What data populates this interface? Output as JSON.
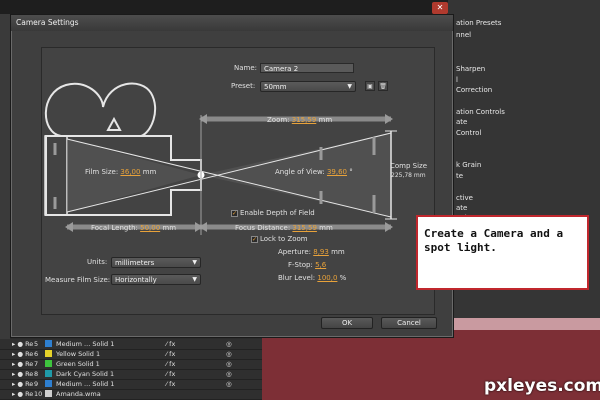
{
  "background": {
    "right_panel_items": [
      "ation Presets",
      "nnel",
      "Sharpen",
      "l",
      "Correction",
      "ation Controls",
      "ate",
      "Control",
      "k Grain",
      "te",
      "ctive",
      "ate",
      "nel"
    ]
  },
  "dialog": {
    "title": "Camera Settings",
    "name_label": "Name:",
    "name_value": "Camera 2",
    "preset_label": "Preset:",
    "preset_value": "50mm",
    "zoom_label": "Zoom:",
    "zoom_value": "315,59",
    "zoom_unit": "mm",
    "film_size_label": "Film Size:",
    "film_size_value": "36,00",
    "film_size_unit": "mm",
    "angle_label": "Angle of View:",
    "angle_value": "39,60",
    "angle_unit": "°",
    "comp_size_label": "Comp Size",
    "comp_size_value": "225,78 mm",
    "focal_length_label": "Focal Length:",
    "focal_length_value": "50,00",
    "focal_length_unit": "mm",
    "enable_dof_label": "Enable Depth of Field",
    "enable_dof_checked": true,
    "focus_distance_label": "Focus Distance:",
    "focus_distance_value": "315,59",
    "focus_distance_unit": "mm",
    "lock_zoom_label": "Lock to Zoom",
    "lock_zoom_checked": true,
    "aperture_label": "Aperture:",
    "aperture_value": "8,93",
    "aperture_unit": "mm",
    "fstop_label": "F-Stop:",
    "fstop_value": "5,6",
    "blur_label": "Blur Level:",
    "blur_value": "100,0",
    "blur_unit": "%",
    "units_label": "Units:",
    "units_value": "millimeters",
    "measure_label": "Measure Film Size:",
    "measure_value": "Horizontally",
    "ok_label": "OK",
    "cancel_label": "Cancel"
  },
  "timeline": {
    "layers": [
      {
        "num": "5",
        "name": "Medium ... Solid 1",
        "color": "#2e7fd0"
      },
      {
        "num": "6",
        "name": "Yellow Solid 1",
        "color": "#e6d22a"
      },
      {
        "num": "7",
        "name": "Green Solid 1",
        "color": "#3ec43e"
      },
      {
        "num": "8",
        "name": "Dark Cyan Solid 1",
        "color": "#1f9aa8"
      },
      {
        "num": "9",
        "name": "Medium ... Solid 1",
        "color": "#2e7fd0"
      },
      {
        "num": "10",
        "name": "Amanda.wma",
        "color": "#cfcfcf"
      }
    ]
  },
  "callout": {
    "text": "Create a Camera and a spot light."
  },
  "watermark": "pxleyes.com"
}
